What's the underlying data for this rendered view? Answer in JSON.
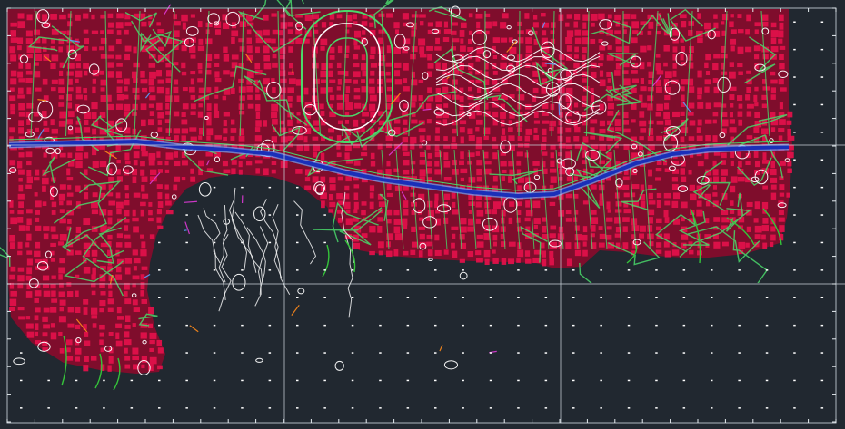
{
  "viewport": {
    "background": "#212830",
    "grid_color": "#c8d0d8",
    "grid_tick_color": "#e8eef2",
    "point_color": "#ffffff"
  },
  "layers": {
    "buildings": "#e0114a",
    "buildings_dark": "#8a0a2c",
    "roads": "#4ad86a",
    "contours": "#ffffff",
    "river": "#1a2fb8",
    "river_edge": "#6ea8ff",
    "vegetation": "#35c43a",
    "accent_orange": "#ff8a1a",
    "accent_magenta": "#e03ad8",
    "accent_blue": "#5aa0ff"
  }
}
